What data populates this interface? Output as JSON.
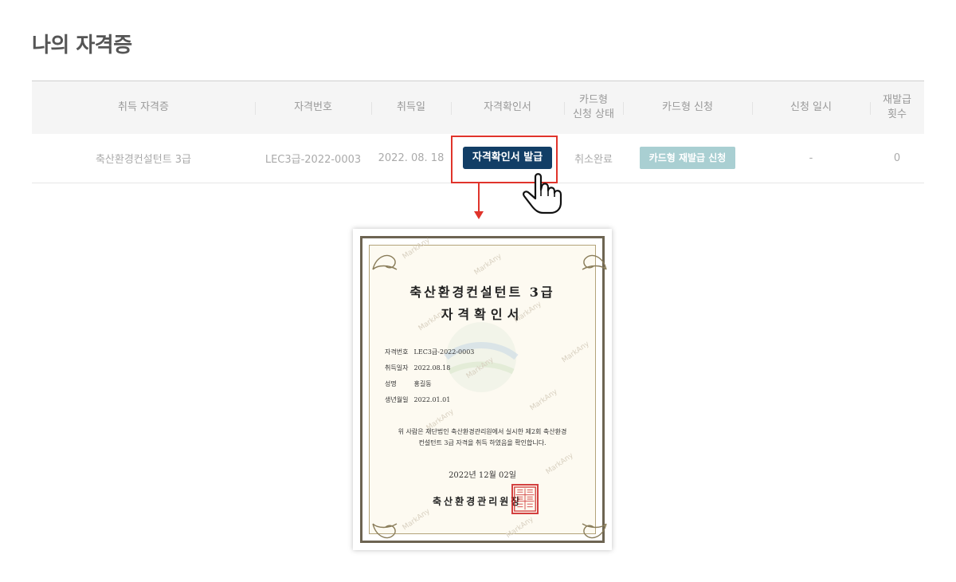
{
  "page": {
    "title": "나의 자격증"
  },
  "table": {
    "headers": [
      "취득 자격증",
      "자격번호",
      "취득일",
      "자격확인서",
      "카드형\n신청 상태",
      "카드형 신청",
      "신청 일시",
      "재발급\n횟수"
    ],
    "row": {
      "qualification": "축산환경컨설턴트 3급",
      "number": "LEC3급-2022-0003",
      "date": "2022. 08. 18",
      "issue_button": "자격확인서 발급",
      "card_status": "취소완료",
      "reissue_button": "카드형 재발급 신청",
      "apply_datetime": "-",
      "reissue_count": "0"
    }
  },
  "certificate": {
    "title_line1": "축산환경컨설턴트 3급",
    "title_line2": "자격확인서",
    "fields": [
      {
        "label": "자격번호",
        "value": "LEC3급-2022-0003"
      },
      {
        "label": "취득일자",
        "value": "2022.08.18"
      },
      {
        "label": "성명",
        "value": "홍길동"
      },
      {
        "label": "생년월일",
        "value": "2022.01.01"
      }
    ],
    "body_line1": "위 사람은 재단법인 축산환경관리원에서 실시한 제2회 축산환경",
    "body_line2": "컨설턴트 3급 자격을 취득 하였음을 확인합니다.",
    "date": "2022년 12월 02일",
    "issuer": "축산환경관리원장",
    "seal_text": "축산환경관리원인",
    "watermark": "MarkAny"
  },
  "icons": {
    "pointer": "hand-pointer-icon"
  },
  "colors": {
    "primary_button": "#123e66",
    "secondary_button": "#a9cfd2",
    "highlight": "#e0342b"
  }
}
